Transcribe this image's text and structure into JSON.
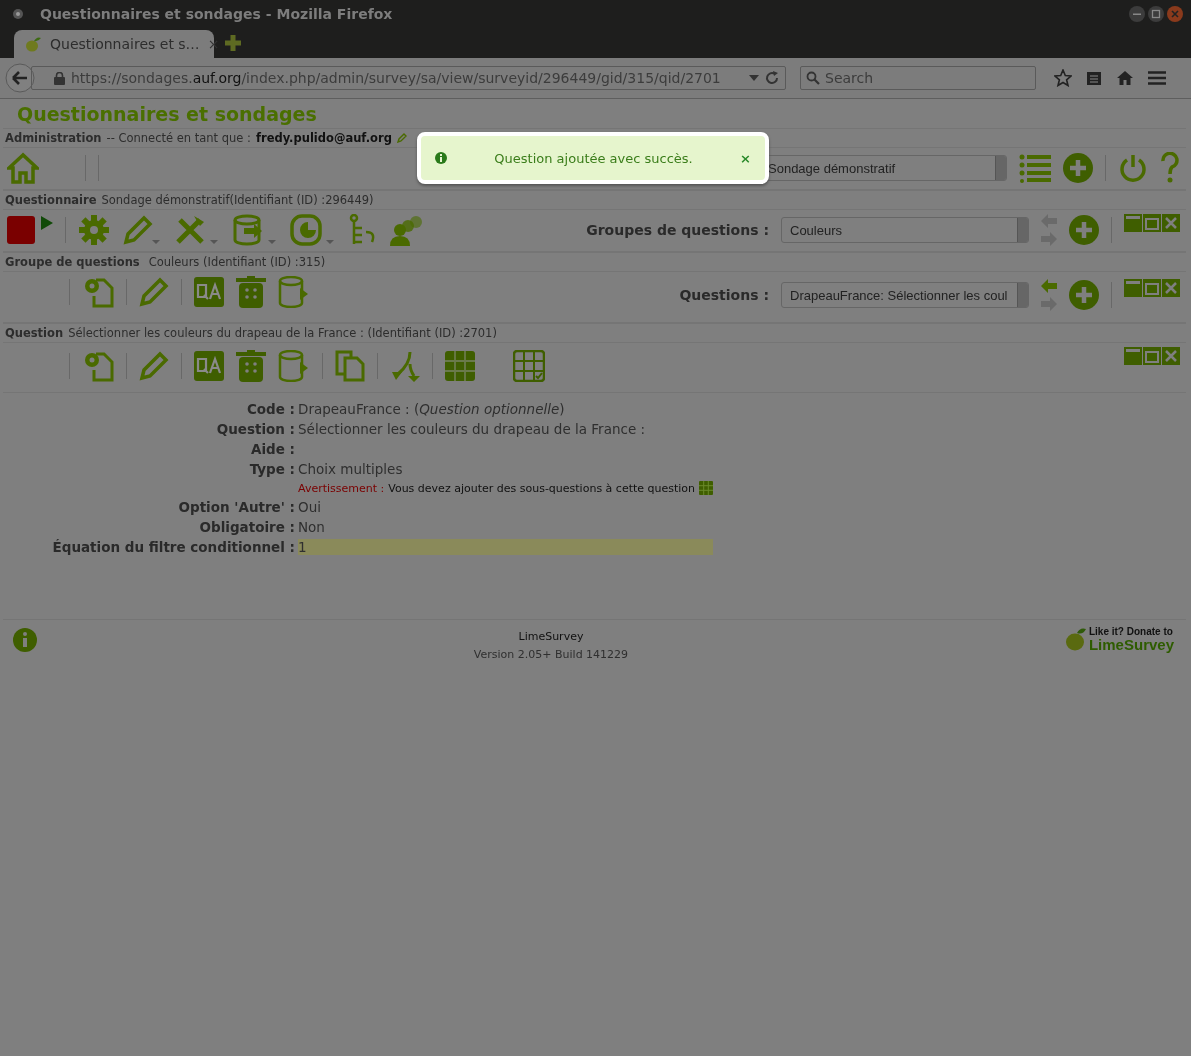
{
  "browser": {
    "window_title": "Questionnaires et sondages - Mozilla Firefox",
    "tab_title": "Questionnaires et s…",
    "tab_close": "×",
    "url": "https://sondages.**auf.org**/index.php/admin/survey/sa/view/surveyid/296449/gid/315/qid/2701",
    "search": {
      "placeholder": "Search"
    }
  },
  "page": {
    "title": "Questionnaires et sondages",
    "admin_bar": {
      "label": "Administration",
      "text": "-- Connecté en tant que :",
      "user": "fredy.pulido@auf.org"
    },
    "survey_select": {
      "value": "Sondage démonstratif"
    },
    "toast": {
      "message": "Question ajoutée avec succès.",
      "close": "×"
    },
    "survey_bar": {
      "label": "Questionnaire",
      "text": "Sondage démonstratif(Identifiant (ID) :296449)",
      "selector_label": "Groupes de questions :",
      "selector_value": "Couleurs",
      "prev_disabled": true,
      "next_disabled": true
    },
    "group_bar": {
      "label": "Groupe de questions",
      "text": "Couleurs (Identifiant (ID) :315)",
      "selector_label": "Questions :",
      "selector_value": "DrapeauFrance: Sélectionner les coul",
      "prev_disabled": false,
      "next_disabled": true
    },
    "question_bar": {
      "label": "Question",
      "text": "Sélectionner les couleurs du drapeau de la France : (Identifiant (ID) :2701)"
    },
    "details": [
      {
        "kind": "field",
        "label": "Code :",
        "value": "DrapeauFrance : (*Question optionnelle*)"
      },
      {
        "kind": "field",
        "label": "Question :",
        "value": "Sélectionner les couleurs du drapeau de la France :"
      },
      {
        "kind": "field",
        "label": "Aide :"
      },
      {
        "kind": "field",
        "label": "Type :",
        "value": "Choix multiples"
      },
      {
        "kind": "warning",
        "label": "Avertissement :",
        "value": "Vous devez ajouter des sous-questions à cette question"
      },
      {
        "kind": "field",
        "label": "Option 'Autre' :",
        "value": "Oui"
      },
      {
        "kind": "field",
        "label": "Obligatoire :",
        "value": "Non"
      },
      {
        "kind": "highlight",
        "label": "Équation du filtre conditionnel :",
        "value": "1"
      }
    ],
    "footer": {
      "name": "LimeSurvey",
      "version": "Version 2.05+ Build 141229",
      "donate_text": "Like it? Donate to",
      "donate_brand": "LimeSurvey"
    }
  }
}
